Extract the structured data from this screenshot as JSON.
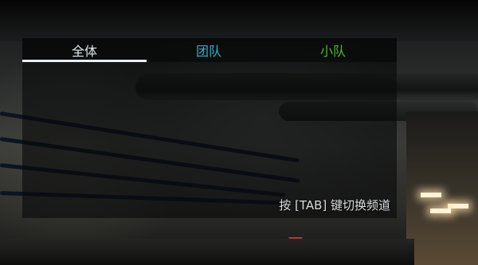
{
  "chat": {
    "tabs": [
      {
        "label": "全体",
        "color": "#dfe6ea",
        "active": true
      },
      {
        "label": "团队",
        "color": "#27b3c6",
        "active": false
      },
      {
        "label": "小队",
        "color": "#4cbb2a",
        "active": false
      }
    ],
    "hint": "按 [TAB] 键切换频道",
    "active_underline_color": "#e8eef2"
  }
}
